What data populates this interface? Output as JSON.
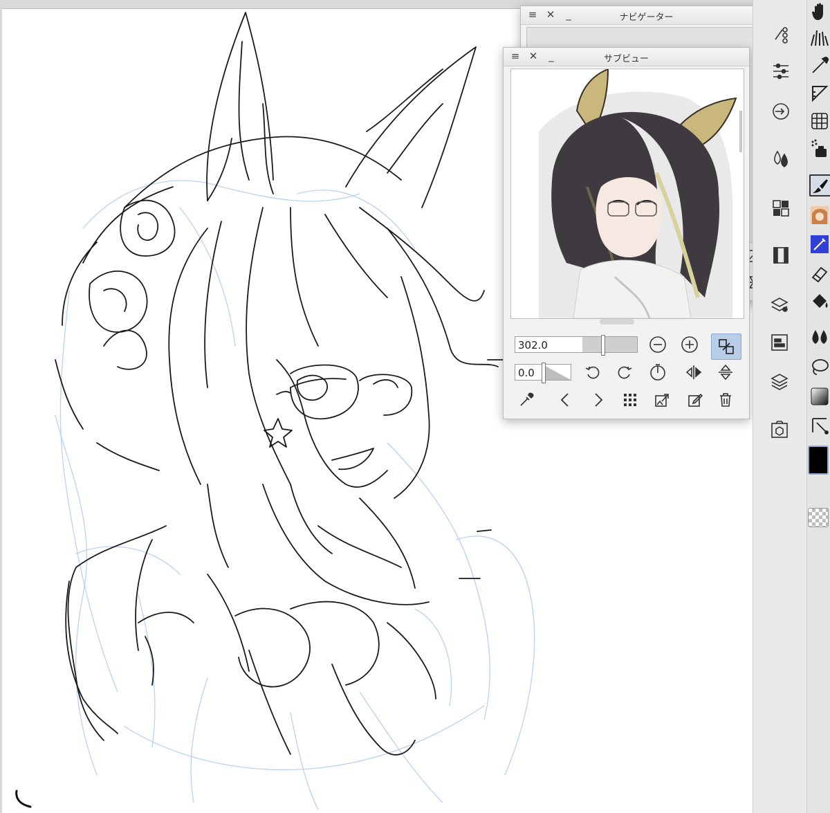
{
  "navigator_panel": {
    "title": "ナビゲーター",
    "menu_icon": "hamburger-icon",
    "close_icon": "close-icon",
    "minimize_icon": "minimize-icon"
  },
  "subview_panel": {
    "title": "サブビュー",
    "menu_icon": "hamburger-icon",
    "close_icon": "close-icon",
    "minimize_icon": "minimize-icon",
    "zoom_value": "302.0",
    "rotation_value": "0.0",
    "zoom_fill": 0.55,
    "rotation_fill": 0.5,
    "zoom_buttons": [
      "zoom-out-icon",
      "zoom-in-icon",
      "fit-to-window-icon"
    ],
    "rotate_buttons": [
      "rotate-left-icon",
      "rotate-right-icon",
      "reset-rotation-icon",
      "flip-horizontal-icon",
      "flip-vertical-icon"
    ],
    "bottom_buttons": [
      "eyedropper-icon",
      "previous-image-icon",
      "next-image-icon",
      "grid-icon",
      "import-image-icon",
      "edit-image-icon",
      "trash-icon"
    ]
  },
  "palette_icons": [
    "sub-tool-detail-icon",
    "tool-property-icon",
    "navigator-icon",
    "color-set-icon",
    "material-icon",
    "animation-icon",
    "layer-property-icon",
    "layer-icon",
    "history-icon",
    "3d-material-icon"
  ],
  "tool_icons": [
    "hand-icon",
    "grass-brush-icon",
    "pen-icon",
    "ruler-icon",
    "grid-icon",
    "spray-icon",
    "brush-icon",
    "reference-thumbnail-icon",
    "blue-pen-icon",
    "eraser-icon",
    "fill-bucket-icon",
    "blend-icon",
    "lasso-icon",
    "gradient-icon",
    "move-icon",
    "main-color-swatch",
    "transparent-color-swatch"
  ],
  "colors": {
    "main_color": "#000000",
    "accent_blue": "#b8cde8",
    "panel_bg": "#f2f2f2"
  }
}
